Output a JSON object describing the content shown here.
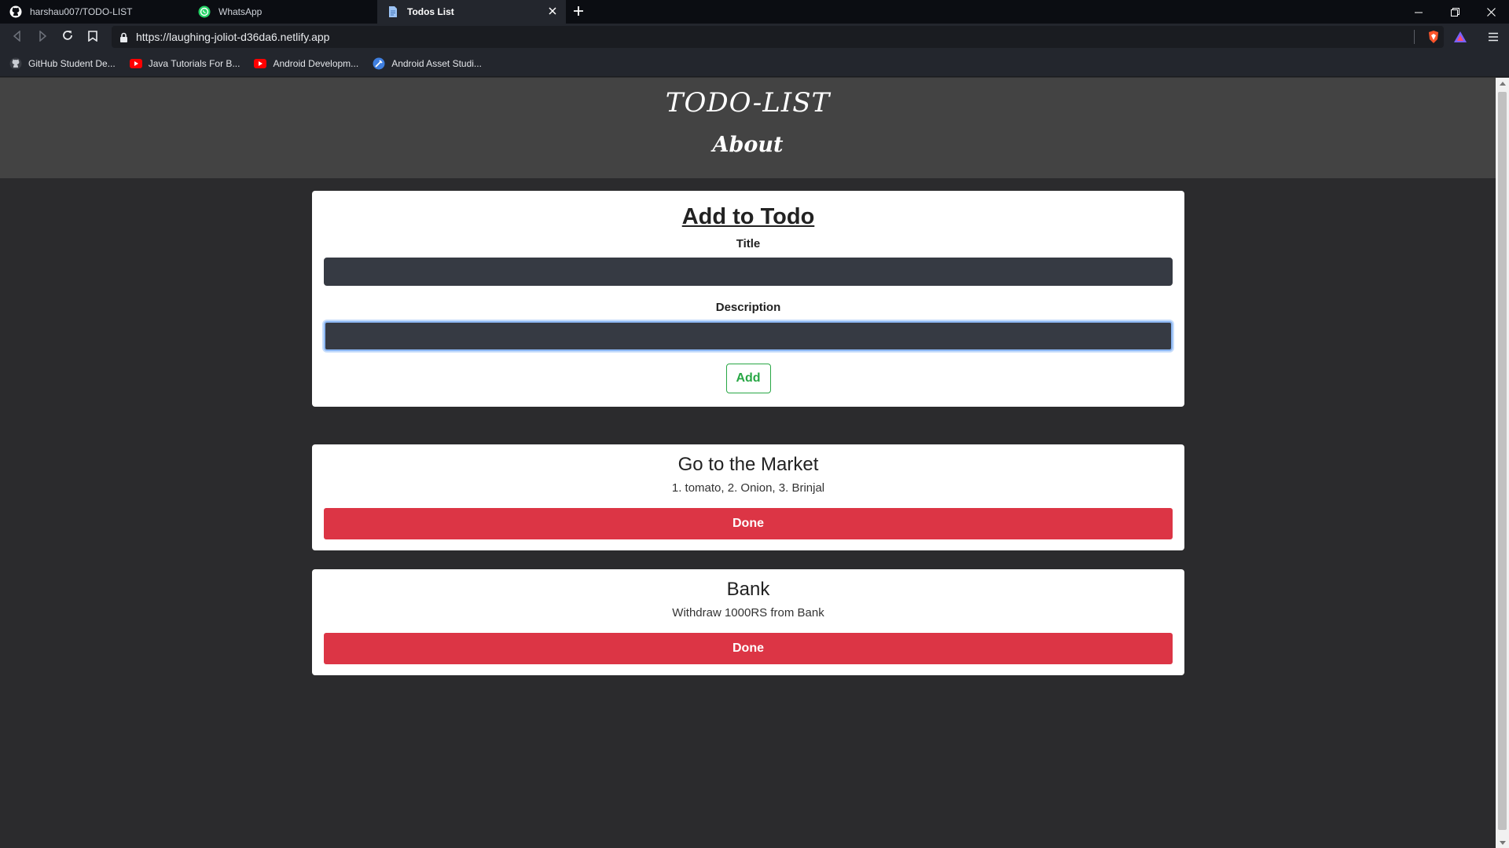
{
  "browser": {
    "tabs": [
      {
        "title": "harshau007/TODO-LIST",
        "icon": "github-icon",
        "active": false
      },
      {
        "title": "WhatsApp",
        "icon": "whatsapp-icon",
        "active": false
      },
      {
        "title": "Todos List",
        "icon": "document-icon",
        "active": true
      }
    ],
    "url": "https://laughing-joliot-d36da6.netlify.app",
    "bookmarks": [
      {
        "label": "GitHub Student De...",
        "icon": "github-icon"
      },
      {
        "label": "Java Tutorials For B...",
        "icon": "youtube-icon"
      },
      {
        "label": "Android Developm...",
        "icon": "youtube-icon"
      },
      {
        "label": "Android Asset Studi...",
        "icon": "android-studio-icon"
      }
    ]
  },
  "header": {
    "title": "TODO-LIST",
    "nav_about": "About"
  },
  "form": {
    "heading": "Add to Todo",
    "title_label": "Title",
    "title_value": "",
    "description_label": "Description",
    "description_value": "",
    "add_label": "Add"
  },
  "todos": [
    {
      "title": "Go to the Market",
      "desc": "1. tomato, 2. Onion, 3. Brinjal",
      "action": "Done"
    },
    {
      "title": "Bank",
      "desc": "Withdraw 1000RS from Bank",
      "action": "Done"
    }
  ],
  "colors": {
    "header_bg": "#434343",
    "page_bg": "#2b2b2d",
    "input_bg": "#363a43",
    "add_green": "#28a745",
    "done_red": "#dc3545"
  }
}
